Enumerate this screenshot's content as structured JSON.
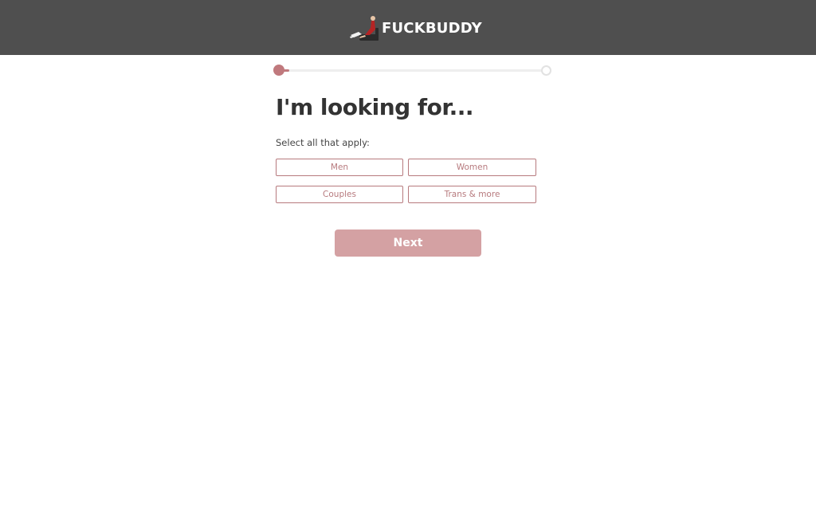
{
  "header": {
    "brand_name": "FUCKBUDDY",
    "logo_icon": "couple-on-couch-logo-icon",
    "background": "#4f4f4f"
  },
  "progress": {
    "fraction": 0.04,
    "accent": "#c0797d"
  },
  "main": {
    "title": "I'm looking for...",
    "subtitle": "Select all that apply:",
    "options": [
      {
        "label": "Men"
      },
      {
        "label": "Women"
      },
      {
        "label": "Couples"
      },
      {
        "label": "Trans & more"
      }
    ],
    "next_label": "Next"
  },
  "colors": {
    "accent": "#b77a7e",
    "button_bg": "#d4a1a3"
  }
}
